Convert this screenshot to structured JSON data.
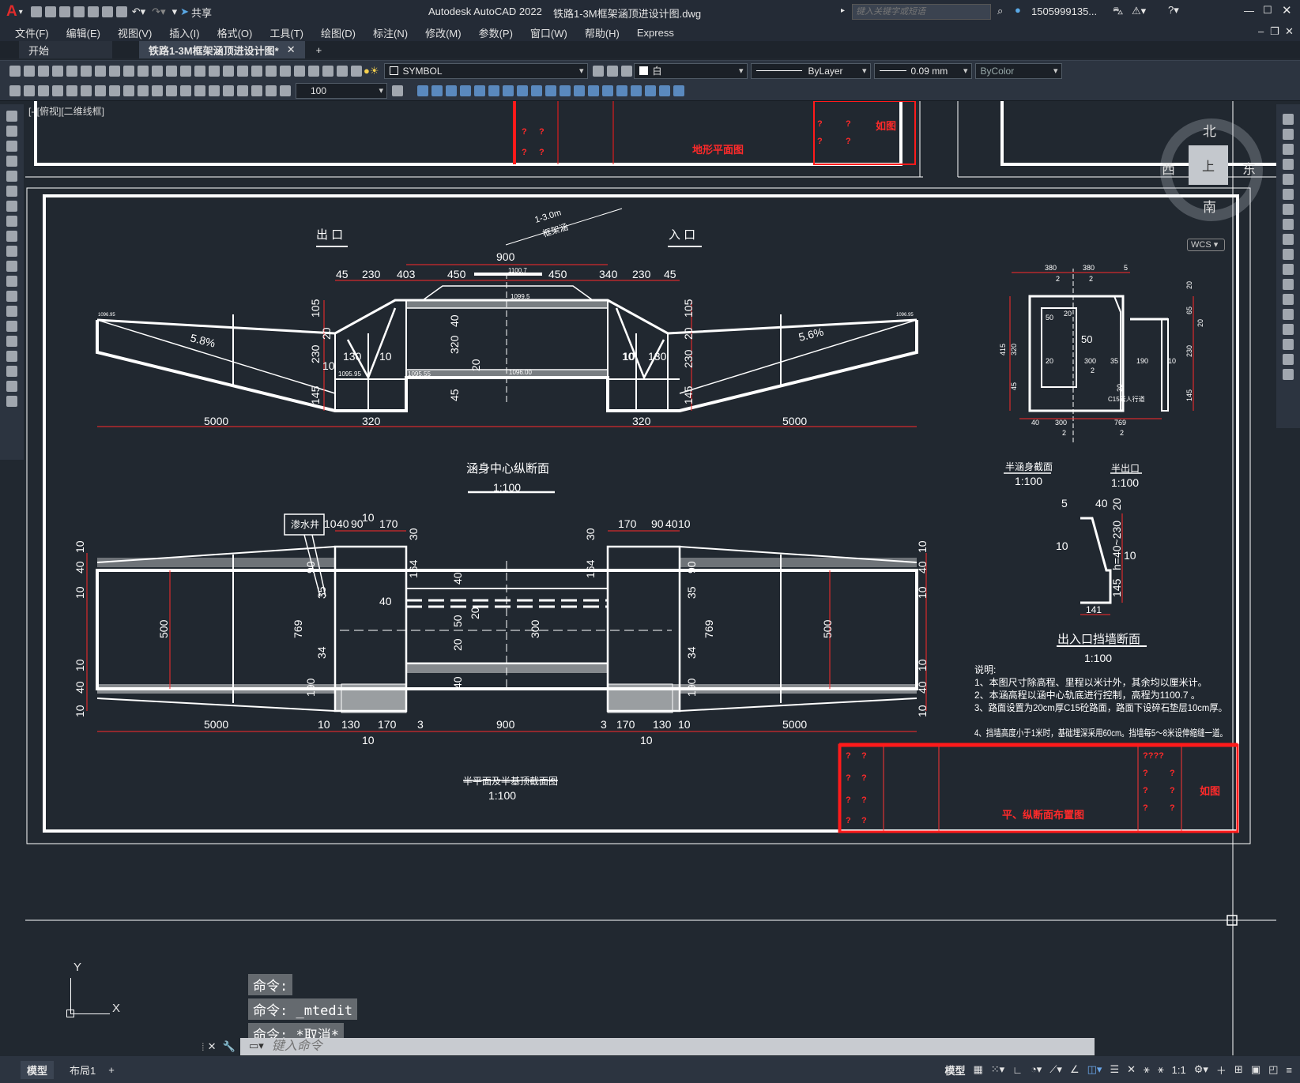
{
  "app": {
    "title": "Autodesk AutoCAD 2022",
    "file": "铁路1-3M框架涵顶进设计图.dwg",
    "share": "共享",
    "search_placeholder": "键入关键字或短语",
    "user": "1505999135..."
  },
  "menu": [
    "文件(F)",
    "编辑(E)",
    "视图(V)",
    "插入(I)",
    "格式(O)",
    "工具(T)",
    "绘图(D)",
    "标注(N)",
    "修改(M)",
    "参数(P)",
    "窗口(W)",
    "帮助(H)",
    "Express"
  ],
  "tabs": [
    {
      "label": "开始"
    },
    {
      "label": "铁路1-3M框架涵顶进设计图*"
    }
  ],
  "toolbar": {
    "layer": "SYMBOL",
    "color": "白",
    "linetype": "ByLayer",
    "lineweight": "0.09 mm",
    "plotstyle": "ByColor",
    "scale": "100"
  },
  "viewport": {
    "label": "[-][俯视][二维线框]"
  },
  "viewcube": {
    "n": "北",
    "s": "南",
    "e": "东",
    "w": "西",
    "face": "上",
    "wcs": "WCS"
  },
  "drawing": {
    "top_title": "地形平面图",
    "top_sheet": "如图",
    "qq": "?",
    "out_label": "出 口",
    "in_label": "入 口",
    "culvert_tag": "1-3.0m",
    "culvert_tag2": "框架涵",
    "dims_top": [
      "45",
      "230",
      "403",
      "900",
      "450",
      "450",
      "340",
      "230",
      "45"
    ],
    "dims_left_v": [
      "105",
      "20",
      "230",
      "10",
      "145"
    ],
    "dims_right_v": [
      "105",
      "20",
      "230",
      "10",
      "145"
    ],
    "inner_dims": [
      "130",
      "10",
      "10",
      "130",
      "40",
      "320",
      "20",
      "45"
    ],
    "elev": [
      "1099.5",
      "1095.55",
      "1096.00",
      "1100.7",
      "1095.95",
      "1096.95",
      "1096.95"
    ],
    "slope_l": "5.8%",
    "slope_r": "5.6%",
    "bottom_dims_1": [
      "5000",
      "320",
      "320",
      "5000"
    ],
    "title1": "涵身中心纵断面",
    "scale1": "1:100",
    "drain": "渗水井",
    "dims_plan_top_l": [
      "10",
      "40",
      "90",
      "10",
      "170"
    ],
    "dims_plan_top_r": [
      "170",
      "90",
      "40",
      "10"
    ],
    "plan_vdims_l": [
      "10",
      "40",
      "10",
      "10",
      "40",
      "10"
    ],
    "plan_vdims_r": [
      "10",
      "40",
      "10",
      "10",
      "40",
      "10"
    ],
    "plan_inner": [
      "500",
      "769",
      "90",
      "35",
      "34",
      "190",
      "30",
      "164",
      "40",
      "50",
      "20",
      "300",
      "20",
      "40",
      "40",
      "164",
      "30",
      "90",
      "35",
      "34",
      "190",
      "769",
      "500"
    ],
    "bottom_dims_2": [
      "5000",
      "10",
      "130",
      "170",
      "3",
      "900",
      "3",
      "170",
      "130",
      "10",
      "5000"
    ],
    "bottom_dims_3": [
      "10",
      "10"
    ],
    "title2": "半平面及半基顶截面图",
    "scale2": "1:100",
    "sec_dims": [
      "380",
      "2",
      "380",
      "2",
      "5",
      "50",
      "20",
      "50",
      "300",
      "2",
      "35",
      "190",
      "10",
      "415",
      "320",
      "45",
      "20",
      "30",
      "40",
      "300",
      "2",
      "769",
      "2",
      "20",
      "65",
      "20",
      "230",
      "145"
    ],
    "sec_note": "C15素人行道",
    "sec1_title": "半涵身截面",
    "sec1_scale": "1:100",
    "sec2_title": "半出口",
    "sec2_scale": "1:100",
    "wall_dims": [
      "5",
      "40",
      "20",
      "10",
      "10",
      "h=40~230",
      "145",
      "141"
    ],
    "wall_title": "出入口挡墙断面",
    "wall_scale": "1:100",
    "notes_title": "说明:",
    "notes": [
      "1、本图尺寸除高程、里程以米计外，其余均以厘米计。",
      "2、本涵高程以涵中心轨底进行控制，高程为1100.7 。",
      "3、路面设置为20cm厚C15砼路面，路面下设碎石垫层10cm厚。",
      "4、挡墙高度小于1米时，基础埋深采用60cm。挡墙每5～8米设伸缩缝一道。"
    ],
    "tb_title": "平、纵断面布置图",
    "tb_sheet": "如图",
    "tb_q4": "????"
  },
  "ucs": {
    "x": "X",
    "y": "Y"
  },
  "command": {
    "history": [
      "命令:",
      "命令: _mtedit",
      "命令: *取消*"
    ],
    "placeholder": "键入命令"
  },
  "status": {
    "model": "模型",
    "layout1": "布局1",
    "add": "+",
    "space": "模型",
    "scale": "1:1"
  },
  "colors": {
    "accent": "#ff0000",
    "line": "#ffffff",
    "bg": "#212830"
  }
}
